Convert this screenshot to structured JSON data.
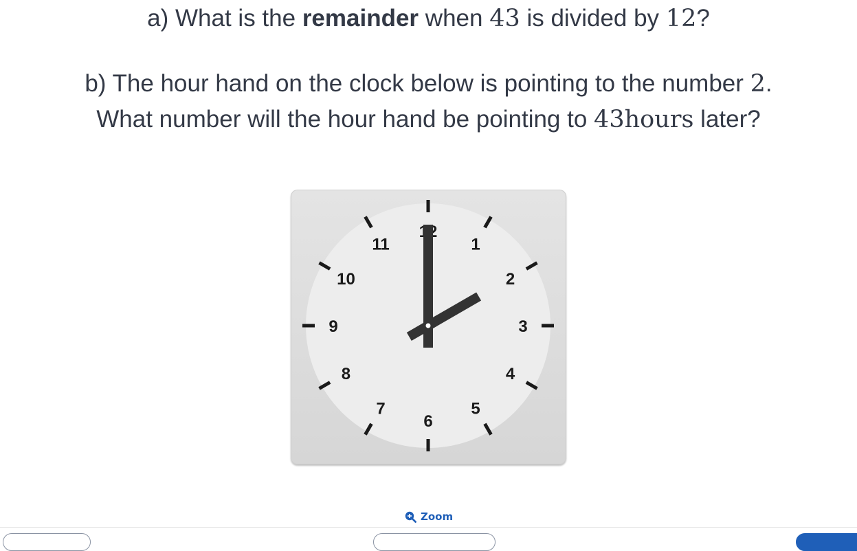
{
  "question_a": {
    "prefix": "a) What is the ",
    "bold": "remainder",
    "mid": " when ",
    "dividend": "43",
    "mid2": " is divided by ",
    "divisor": "12",
    "suffix": "?"
  },
  "question_b": {
    "line1_text": "b) The hour hand on the clock below is pointing to the number ",
    "line1_number": "2",
    "line1_end": ".",
    "line2_text": "What number will the hour hand be pointing to ",
    "line2_number": "43",
    "line2_unit": "hours",
    "line2_end": " later?"
  },
  "clock": {
    "numbers": [
      "12",
      "1",
      "2",
      "3",
      "4",
      "5",
      "6",
      "7",
      "8",
      "9",
      "10",
      "11"
    ],
    "hour_hand_points_to": 2,
    "minute_hand_points_to": 12,
    "face_color": "#ededed",
    "hand_color": "#333333",
    "tick_color": "#1a1a1a"
  },
  "zoom": {
    "label": "Zoom",
    "icon": "zoom-in-icon",
    "color": "#1f5fb8"
  }
}
